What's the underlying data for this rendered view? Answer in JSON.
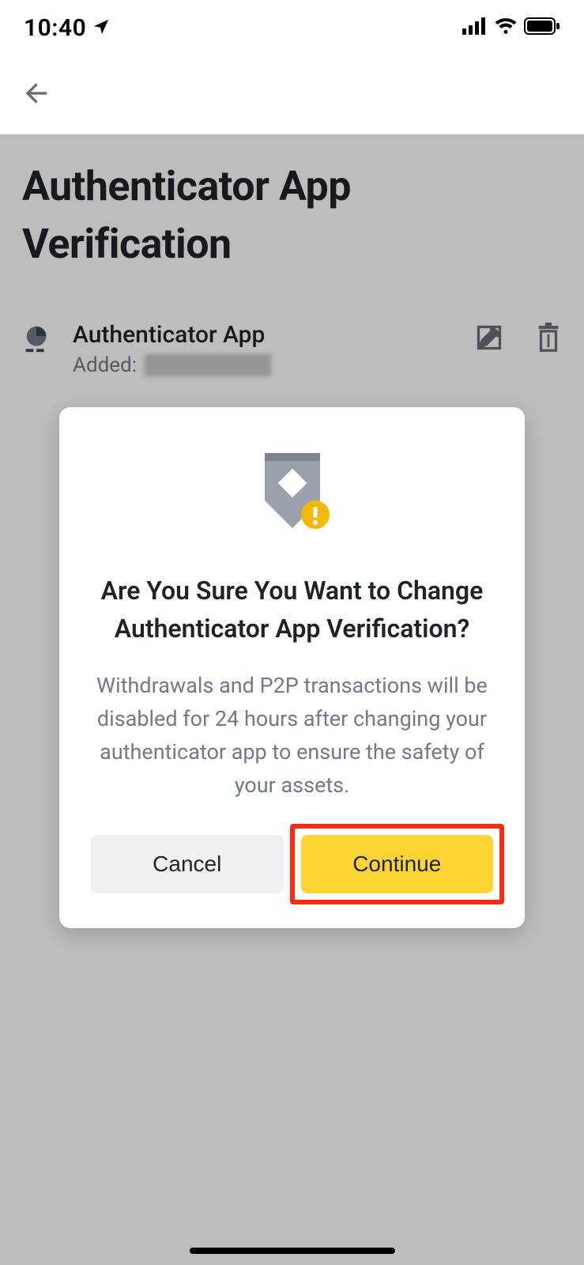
{
  "status_bar": {
    "time": "10:40"
  },
  "page": {
    "title": "Authenticator App Verification",
    "item": {
      "title": "Authenticator App",
      "added_label": "Added:"
    }
  },
  "modal": {
    "title": "Are You Sure You Want to Change Authenticator App Verification?",
    "body": "Withdrawals and P2P transactions will be disabled for 24 hours after changing your authenticator app to ensure the safety of your assets.",
    "cancel": "Cancel",
    "continue": "Continue"
  },
  "colors": {
    "accent": "#fcd535",
    "highlight_border": "#ff2a12",
    "muted": "#707a8a"
  }
}
